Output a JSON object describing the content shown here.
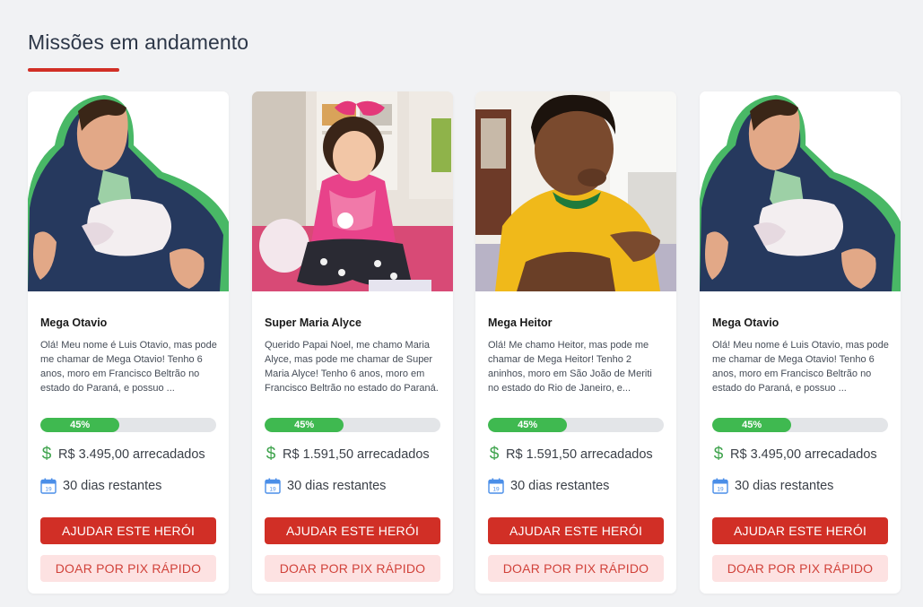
{
  "section": {
    "title": "Missões em andamento"
  },
  "cards": [
    {
      "name": "Mega Otavio",
      "description": "Olá! Meu nome é Luis Otavio, mas pode me chamar de Mega Otavio! Tenho 6 anos, moro em Francisco Beltrão no estado do Paraná, e possuo ...",
      "progress_label": "45%",
      "progress_fraction": 0.45,
      "raised": "R$ 3.495,00 arrecadados",
      "days_left": "30 dias restantes",
      "help_label": "AJUDAR ESTE HERÓI",
      "pix_label": "DOAR POR PIX RÁPIDO",
      "calendar_day": "19",
      "icons": {
        "money": "dollar-icon",
        "calendar": "calendar-icon"
      }
    },
    {
      "name": "Super Maria Alyce",
      "description": "Querido Papai Noel, me chamo Maria Alyce, mas pode me chamar de Super Maria Alyce! Tenho 6 anos, moro em Francisco Beltrão no estado do Paraná.",
      "progress_label": "45%",
      "progress_fraction": 0.45,
      "raised": "R$ 1.591,50 arrecadados",
      "days_left": "30 dias restantes",
      "help_label": "AJUDAR ESTE HERÓI",
      "pix_label": "DOAR POR PIX RÁPIDO",
      "calendar_day": "19",
      "icons": {
        "money": "dollar-icon",
        "calendar": "calendar-icon"
      }
    },
    {
      "name": "Mega Heitor",
      "description": "Olá! Me chamo Heitor, mas pode me chamar de Mega Heitor! Tenho 2 aninhos, moro em São João de Meriti no estado do Rio de Janeiro, e...",
      "progress_label": "45%",
      "progress_fraction": 0.45,
      "raised": "R$ 1.591,50 arrecadados",
      "days_left": "30 dias restantes",
      "help_label": "AJUDAR ESTE HERÓI",
      "pix_label": "DOAR POR PIX RÁPIDO",
      "calendar_day": "19",
      "icons": {
        "money": "dollar-icon",
        "calendar": "calendar-icon"
      }
    },
    {
      "name": "Mega Otavio",
      "description": "Olá! Meu nome é Luis Otavio, mas pode me chamar de Mega Otavio! Tenho 6 anos, moro em Francisco Beltrão no estado do Paraná, e possuo ...",
      "progress_label": "45%",
      "progress_fraction": 0.45,
      "raised": "R$ 3.495,00 arrecadados",
      "days_left": "30 dias restantes",
      "help_label": "AJUDAR ESTE HERÓI",
      "pix_label": "DOAR POR PIX RÁPIDO",
      "calendar_day": "19",
      "icons": {
        "money": "dollar-icon",
        "calendar": "calendar-icon"
      }
    }
  ],
  "colors": {
    "accent": "#d12f26",
    "progress": "#3fb950",
    "pix_bg": "#fde2e2",
    "money": "#3fa34d",
    "calendar": "#4a8ee8"
  }
}
